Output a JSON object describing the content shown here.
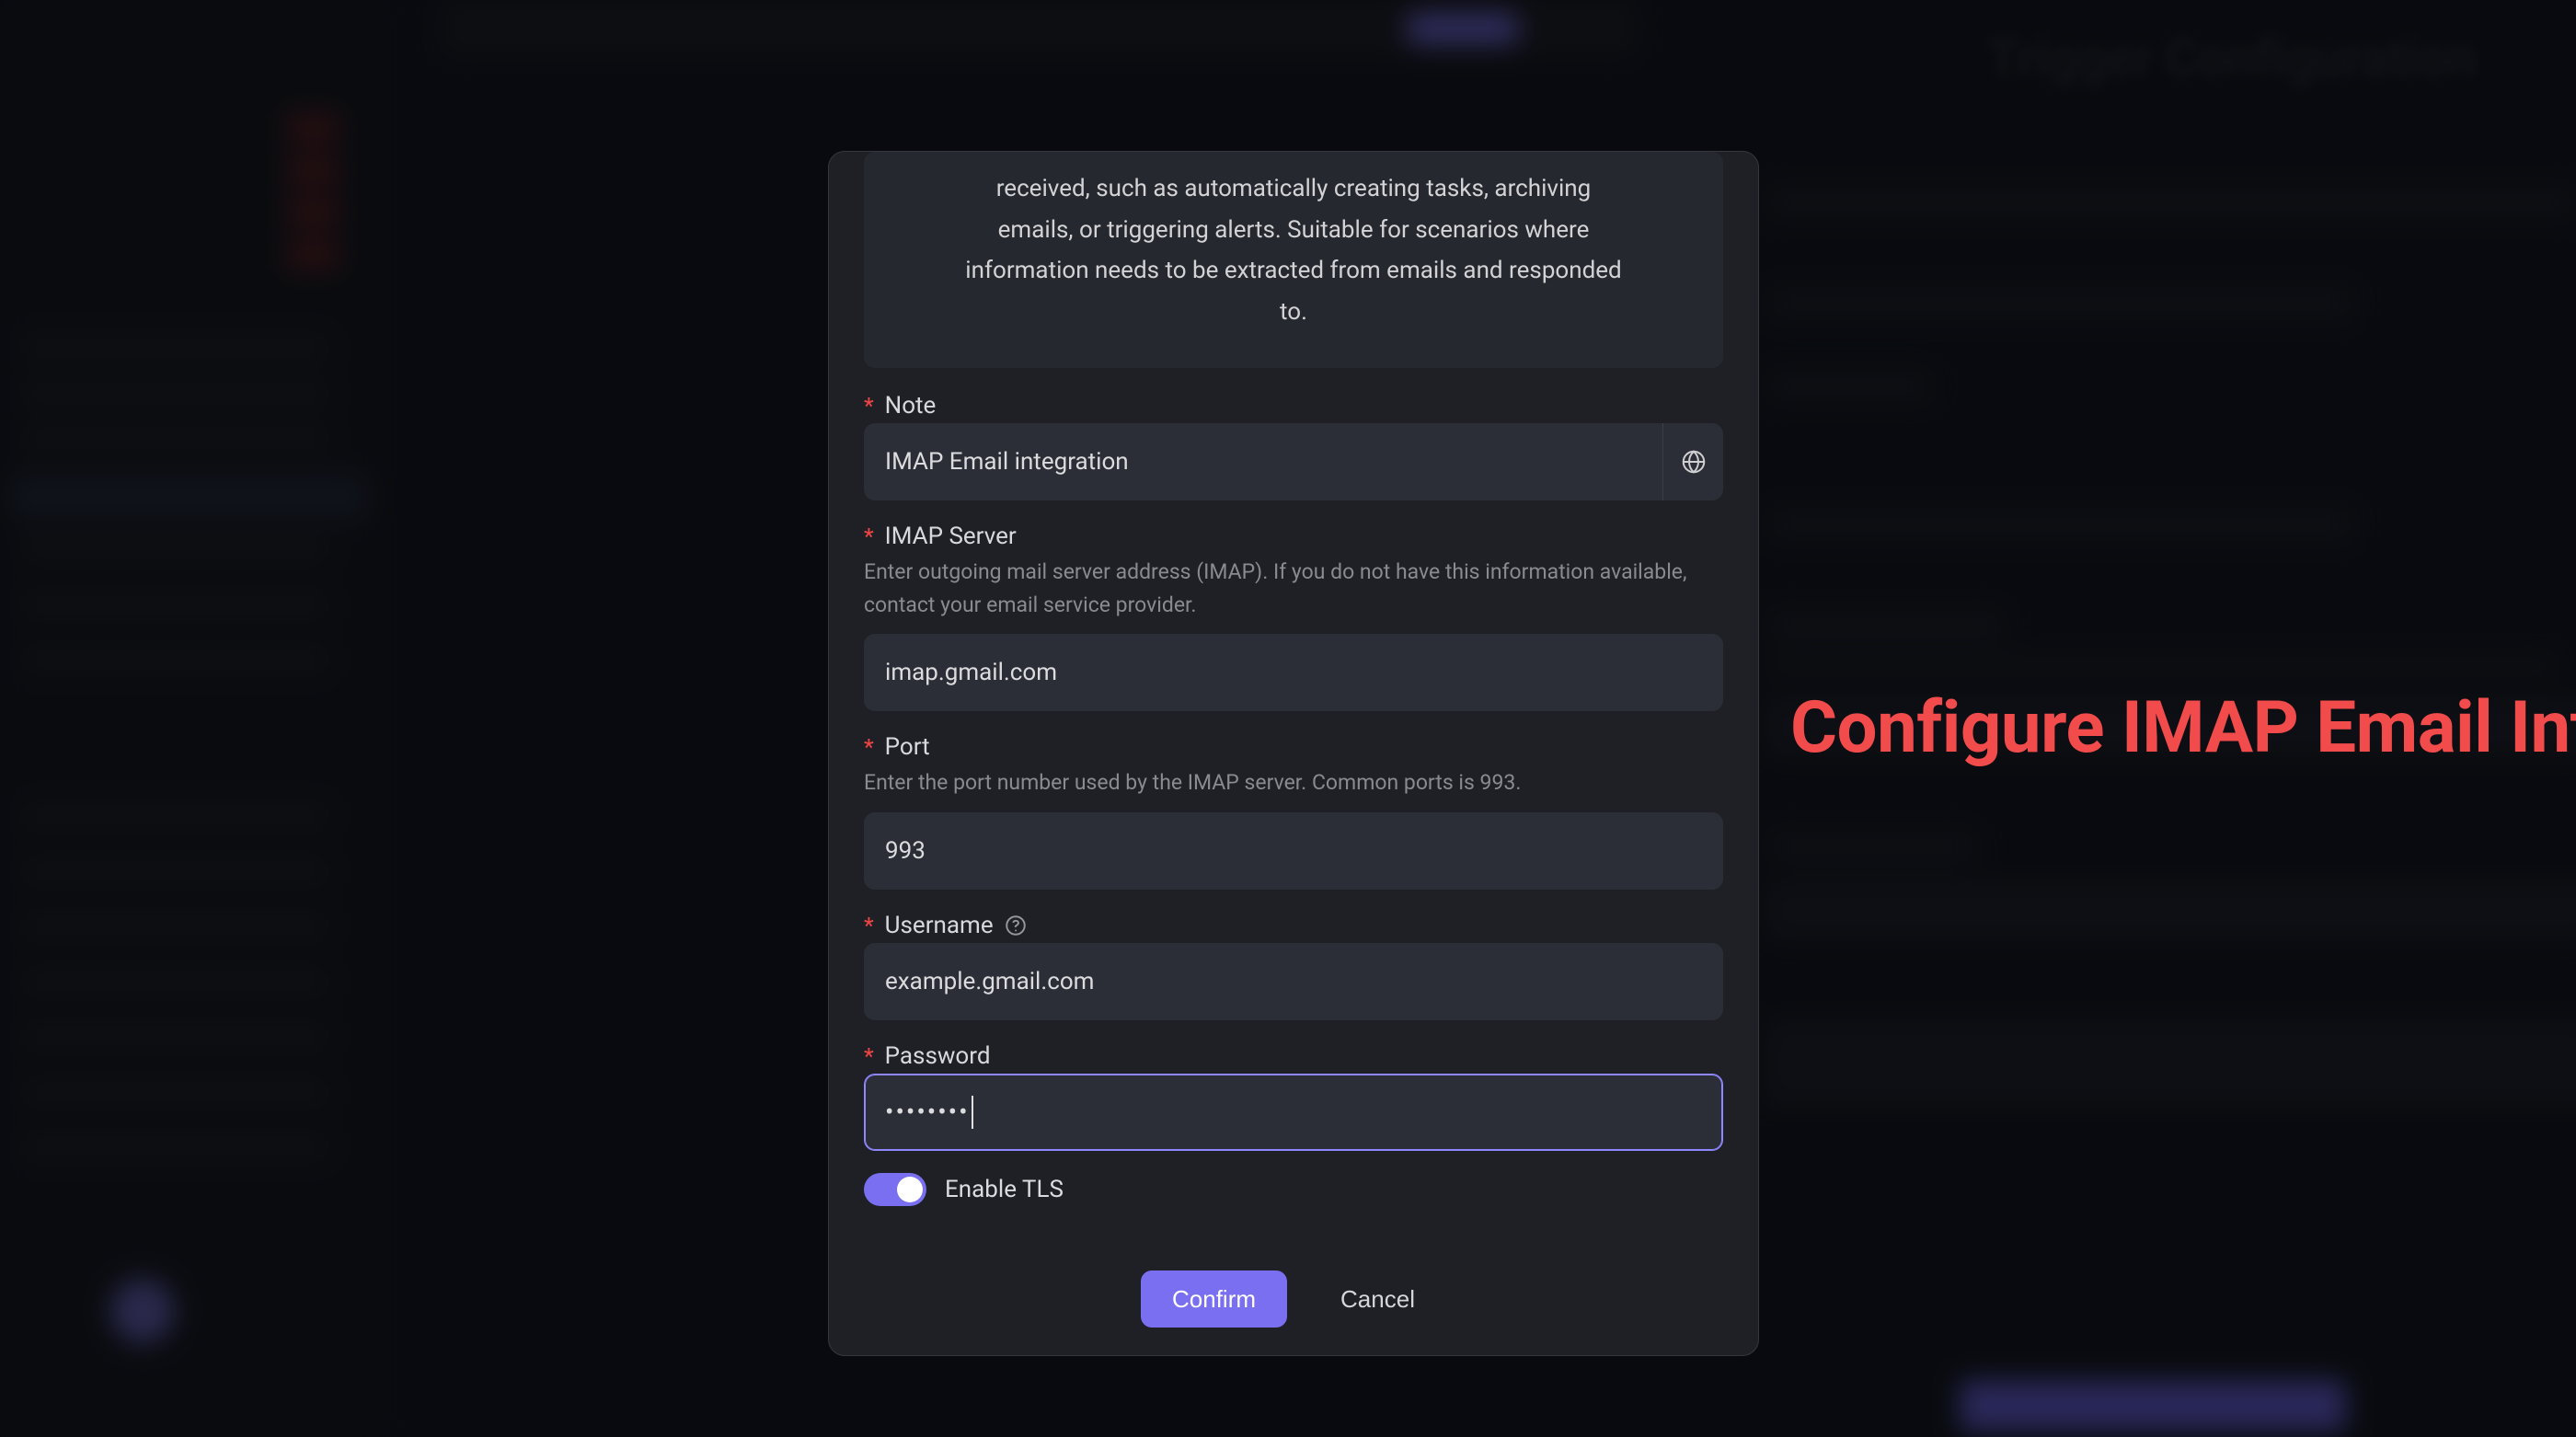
{
  "modal": {
    "intro": "received, such as automatically creating tasks, archiving emails, or triggering alerts. Suitable for scenarios where information needs to be extracted from emails and responded to.",
    "fields": {
      "note": {
        "label": "Note",
        "value": "IMAP Email integration"
      },
      "imap_server": {
        "label": "IMAP Server",
        "helper": "Enter outgoing mail server address (IMAP). If you do not have this information available, contact your email service provider.",
        "value": "imap.gmail.com"
      },
      "port": {
        "label": "Port",
        "helper": "Enter the port number used by the IMAP server. Common ports is 993.",
        "value": "993"
      },
      "username": {
        "label": "Username",
        "value": "example.gmail.com"
      },
      "password": {
        "label": "Password",
        "masked": "••••••••"
      },
      "tls": {
        "label": "Enable TLS",
        "enabled": true
      }
    },
    "buttons": {
      "confirm": "Confirm",
      "cancel": "Cancel"
    }
  },
  "annotation": "Configure IMAP Email Integ",
  "background_title": "Trigger Configuration"
}
